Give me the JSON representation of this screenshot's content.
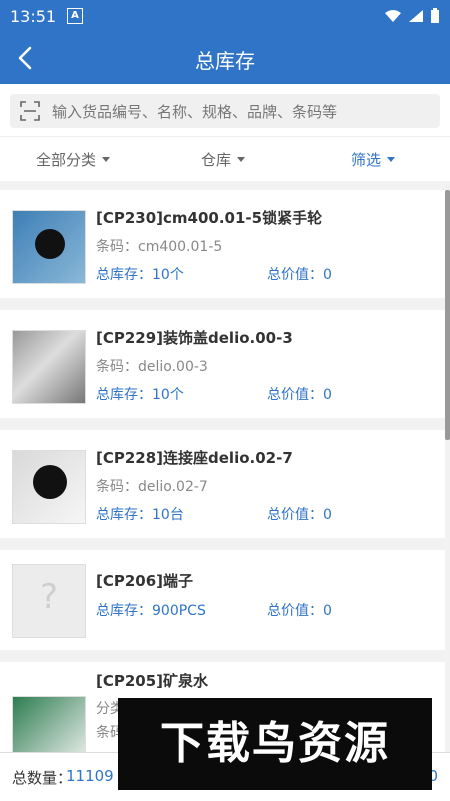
{
  "status": {
    "time": "13:51",
    "a_badge": "A"
  },
  "header": {
    "title": "总库存"
  },
  "search": {
    "placeholder": "输入货品编号、名称、规格、品牌、条码等"
  },
  "filters": [
    {
      "label": "全部分类"
    },
    {
      "label": "仓库"
    },
    {
      "label": "筛选"
    }
  ],
  "items": [
    {
      "name": "[CP230]cm400.01-5锁紧手轮",
      "barcode": "条码：cm400.01-5",
      "stock": "总库存：10个",
      "value": "总价值：0"
    },
    {
      "name": "[CP229]装饰盖delio.00-3",
      "barcode": "条码：delio.00-3",
      "stock": "总库存：10个",
      "value": "总价值：0"
    },
    {
      "name": "[CP228]连接座delio.02-7",
      "barcode": "条码：delio.02-7",
      "stock": "总库存：10台",
      "value": "总价值：0"
    },
    {
      "name": "[CP206]端子",
      "barcode": "",
      "stock": "总库存：900PCS",
      "value": "总价值：0"
    },
    {
      "name": "[CP205]矿泉水",
      "barcode": "分类",
      "stock": "条码",
      "value": ""
    }
  ],
  "footer": {
    "total_label": "总数量：",
    "total_value": "11109",
    "right_value": "0"
  },
  "watermark": {
    "text": "下载鸟资源"
  },
  "colors": {
    "primary": "#2f74c6",
    "text": "#333333",
    "muted": "#888888"
  }
}
